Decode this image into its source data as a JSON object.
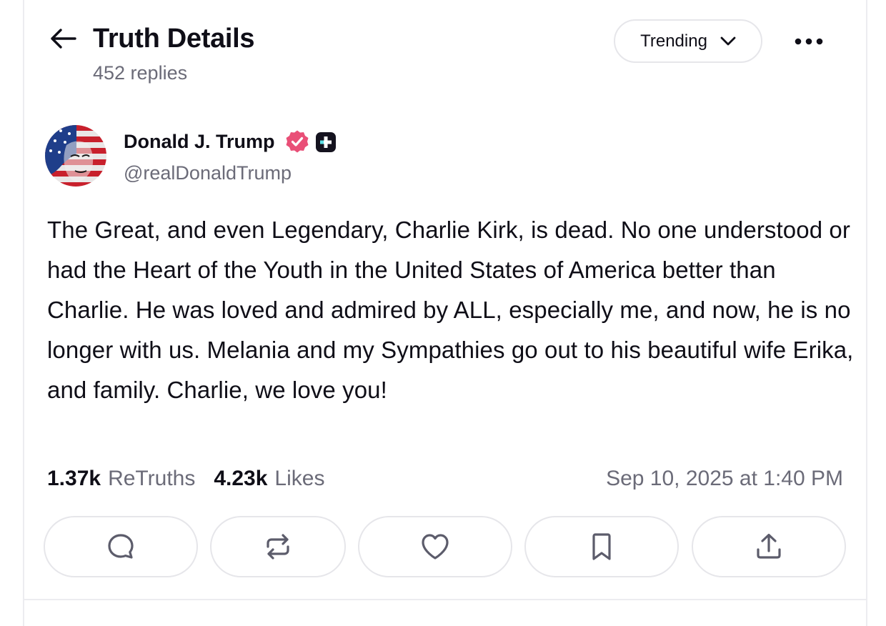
{
  "header": {
    "title": "Truth Details",
    "subtitle": "452 replies",
    "sort_label": "Trending"
  },
  "author": {
    "name": "Donald J. Trump",
    "handle": "@realDonaldTrump"
  },
  "post": {
    "text": "The Great, and even Legendary, Charlie Kirk, is dead. No one understood or had the Heart of the Youth in the United States of America better than Charlie. He was loved and admired by ALL, especially me, and now, he is no longer with us. Melania and my Sympathies go out to his beautiful wife Erika, and family. Charlie, we love you!",
    "retruths_count": "1.37k",
    "retruths_label": "ReTruths",
    "likes_count": "4.23k",
    "likes_label": "Likes",
    "timestamp": "Sep 10, 2025 at 1:40 PM"
  },
  "icons": {
    "back": "arrow-left-icon",
    "sort": "chevron-down-icon",
    "more": "more-horizontal-icon",
    "verified": "verified-badge-icon",
    "plus": "plus-badge-icon",
    "reply": "reply-icon",
    "retruth": "repost-icon",
    "like": "heart-icon",
    "bookmark": "bookmark-icon",
    "share": "share-icon"
  },
  "colors": {
    "verified": "#e94f77",
    "text_primary": "#0f0e17",
    "text_secondary": "#6b6b78",
    "border": "#e6e6ea",
    "icon": "#5c5c6b"
  }
}
